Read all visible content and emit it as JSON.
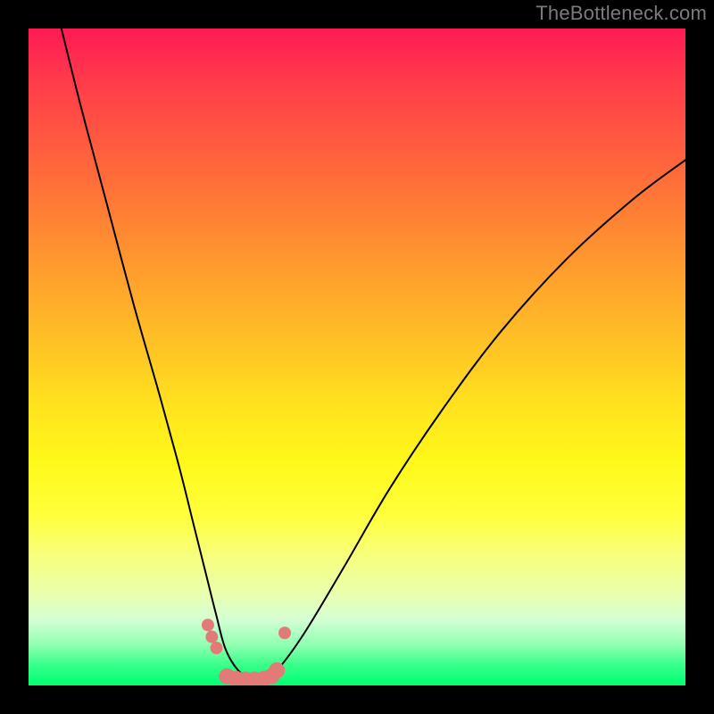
{
  "watermark": "TheBottleneck.com",
  "chart_data": {
    "type": "line",
    "title": "",
    "xlabel": "",
    "ylabel": "",
    "xlim": [
      0,
      100
    ],
    "ylim": [
      0,
      100
    ],
    "grid": false,
    "legend": false,
    "background_gradient": {
      "orientation": "vertical",
      "stops": [
        {
          "pos": 0.0,
          "color": "#ff1a55"
        },
        {
          "pos": 0.5,
          "color": "#ffe41e"
        },
        {
          "pos": 0.8,
          "color": "#f8ff7a"
        },
        {
          "pos": 0.94,
          "color": "#8dffb0"
        },
        {
          "pos": 1.0,
          "color": "#00ff70"
        }
      ]
    },
    "series": [
      {
        "name": "curve",
        "color": "#000000",
        "stroke_width": 2,
        "x": [
          5,
          8,
          12,
          16,
          20,
          23,
          25,
          27,
          28.5,
          30,
          32,
          34,
          36,
          38,
          42,
          48,
          55,
          63,
          72,
          82,
          92,
          100
        ],
        "values": [
          100,
          88,
          73,
          58,
          44,
          33,
          25,
          17,
          11,
          5.5,
          2.2,
          1.0,
          1.0,
          2.5,
          8,
          18,
          30,
          42,
          54,
          65,
          74,
          80
        ]
      },
      {
        "name": "dots-left",
        "type": "scatter",
        "color": "#e27b78",
        "radius": 7,
        "x": [
          27.3,
          27.9,
          28.6
        ],
        "values": [
          9.2,
          7.4,
          5.7
        ]
      },
      {
        "name": "dots-bottom",
        "type": "scatter",
        "color": "#e27b78",
        "radius": 9,
        "x": [
          30.2,
          31.6,
          33.0,
          34.4,
          35.8,
          37.0,
          37.8
        ],
        "values": [
          1.4,
          1.0,
          0.9,
          0.9,
          1.0,
          1.4,
          2.3
        ]
      },
      {
        "name": "dots-right",
        "type": "scatter",
        "color": "#e27b78",
        "radius": 7,
        "x": [
          39.0
        ],
        "values": [
          8.0
        ]
      }
    ]
  }
}
